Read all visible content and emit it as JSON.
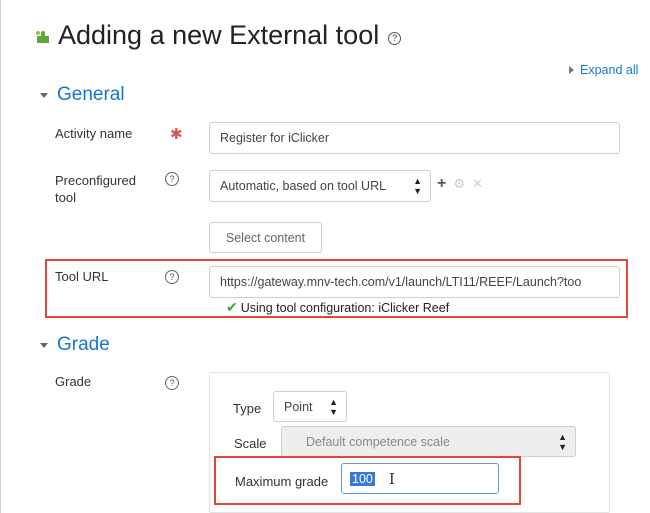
{
  "page": {
    "title": "Adding a new External tool",
    "expand_all": "Expand all"
  },
  "general": {
    "heading": "General",
    "activity_name": {
      "label": "Activity name",
      "value": "Register for iClicker"
    },
    "preconfigured_tool": {
      "label": "Preconfigured tool",
      "selected": "Automatic, based on tool URL"
    },
    "select_content_button": "Select content",
    "tool_url": {
      "label": "Tool URL",
      "value": "https://gateway.mnv-tech.com/v1/launch/LTI11/REEF/Launch?too",
      "status": "Using tool configuration: iClicker Reef"
    }
  },
  "grade": {
    "heading": "Grade",
    "label": "Grade",
    "type": {
      "label": "Type",
      "selected": "Point"
    },
    "scale": {
      "label": "Scale",
      "selected": "Default competence scale"
    },
    "max_grade": {
      "label": "Maximum grade",
      "value": "100"
    }
  },
  "colors": {
    "link_blue": "#1177d1",
    "highlight_red": "#e0463c",
    "required_red": "#d9534f",
    "check_green": "#3aa33a"
  },
  "icons": [
    "puzzle-icon",
    "help-icon",
    "required-icon",
    "expand-triangle-icon",
    "collapse-caret-icon",
    "add-icon",
    "gear-icon",
    "close-icon",
    "checkmark-icon",
    "select-arrows-icon",
    "text-cursor-icon"
  ]
}
